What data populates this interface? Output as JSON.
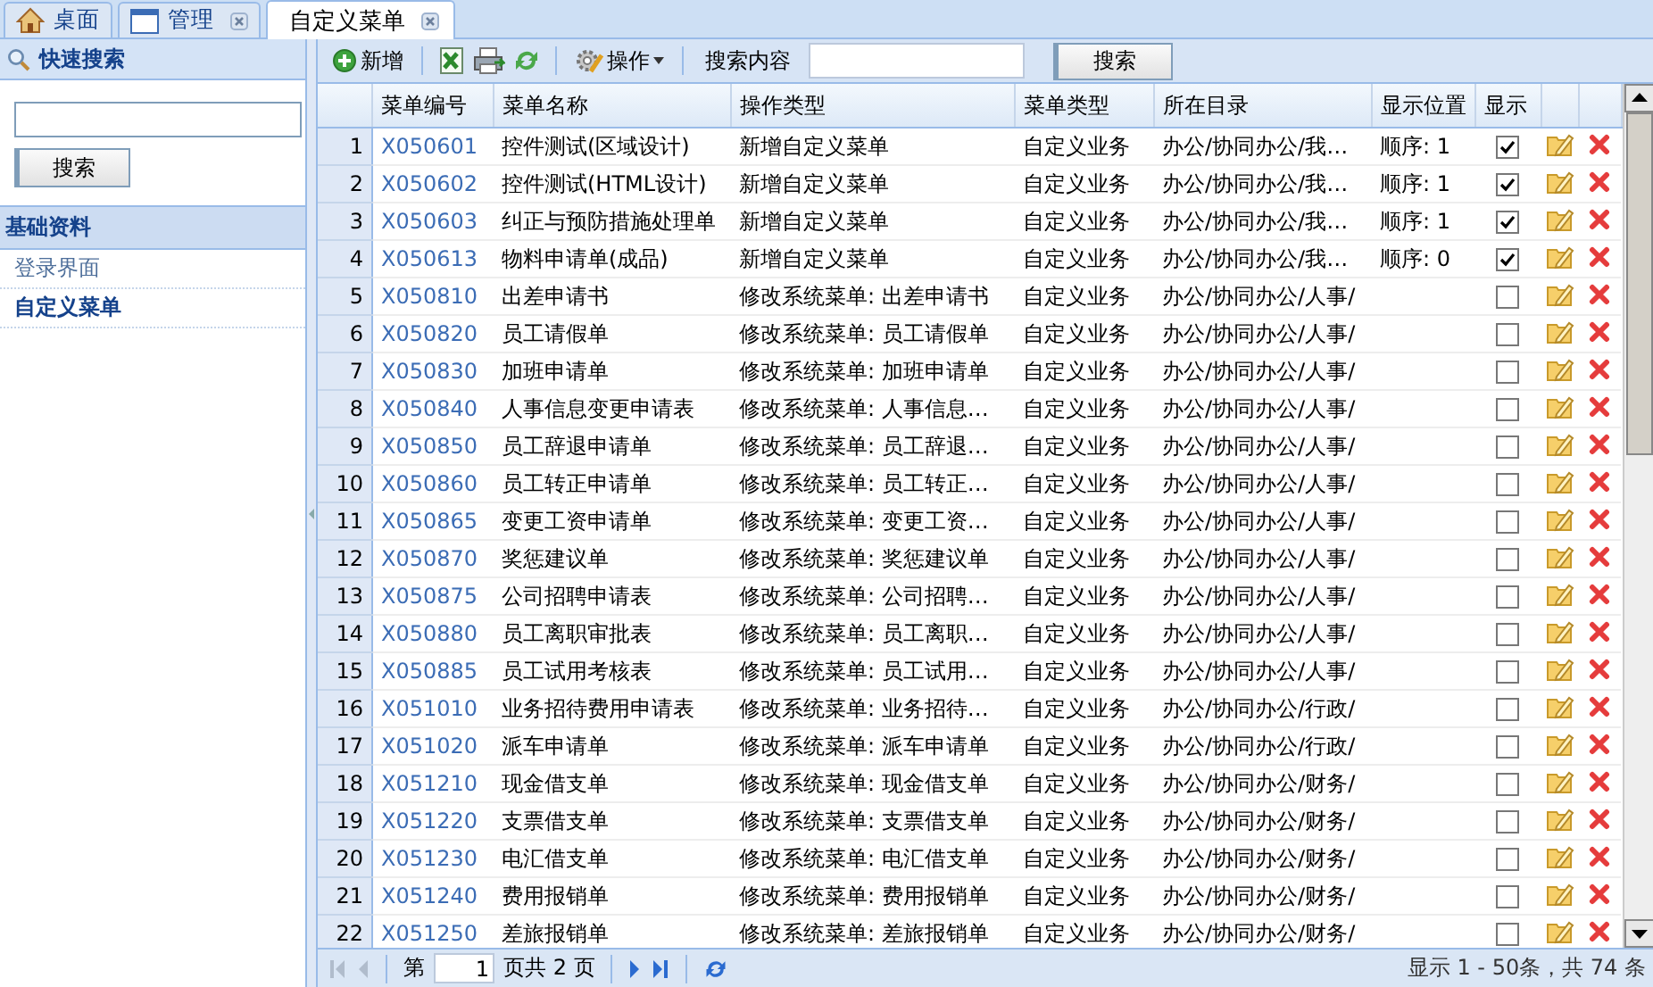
{
  "tabs": [
    {
      "label": "桌面",
      "kind": "home",
      "closable": false,
      "selected": false
    },
    {
      "label": "管理",
      "kind": "window",
      "closable": true,
      "selected": false
    },
    {
      "label": "自定义菜单",
      "kind": "plain",
      "closable": true,
      "selected": true
    }
  ],
  "sidebar": {
    "search_title": "快速搜索",
    "search_button": "搜索",
    "section_title": "基础资料",
    "items": [
      {
        "label": "登录界面",
        "selected": false
      },
      {
        "label": "自定义菜单",
        "selected": true
      }
    ]
  },
  "toolbar": {
    "add": "新增",
    "actions": "操作",
    "search_label": "搜索内容",
    "search_button": "搜索"
  },
  "table": {
    "columns": [
      "菜单编号",
      "菜单名称",
      "操作类型",
      "菜单类型",
      "所在目录",
      "显示位置",
      "显示"
    ],
    "rows": [
      {
        "num": "1",
        "code": "X050601",
        "name": "控件测试(区域设计)",
        "op": "新增自定义菜单",
        "type": "自定义业务",
        "dir": "办公/协同办公/我…",
        "pos": "顺序: 1",
        "shown": true
      },
      {
        "num": "2",
        "code": "X050602",
        "name": "控件测试(HTML设计)",
        "op": "新增自定义菜单",
        "type": "自定义业务",
        "dir": "办公/协同办公/我…",
        "pos": "顺序: 1",
        "shown": true
      },
      {
        "num": "3",
        "code": "X050603",
        "name": "纠正与预防措施处理单",
        "op": "新增自定义菜单",
        "type": "自定义业务",
        "dir": "办公/协同办公/我…",
        "pos": "顺序: 1",
        "shown": true
      },
      {
        "num": "4",
        "code": "X050613",
        "name": "物料申请单(成品)",
        "op": "新增自定义菜单",
        "type": "自定义业务",
        "dir": "办公/协同办公/我…",
        "pos": "顺序: 0",
        "shown": true
      },
      {
        "num": "5",
        "code": "X050810",
        "name": "出差申请书",
        "op": "修改系统菜单: 出差申请书",
        "type": "自定义业务",
        "dir": "办公/协同办公/人事/",
        "shown": false
      },
      {
        "num": "6",
        "code": "X050820",
        "name": "员工请假单",
        "op": "修改系统菜单: 员工请假单",
        "type": "自定义业务",
        "dir": "办公/协同办公/人事/",
        "shown": false
      },
      {
        "num": "7",
        "code": "X050830",
        "name": "加班申请单",
        "op": "修改系统菜单: 加班申请单",
        "type": "自定义业务",
        "dir": "办公/协同办公/人事/",
        "shown": false
      },
      {
        "num": "8",
        "code": "X050840",
        "name": "人事信息变更申请表",
        "op": "修改系统菜单: 人事信息…",
        "type": "自定义业务",
        "dir": "办公/协同办公/人事/",
        "shown": false
      },
      {
        "num": "9",
        "code": "X050850",
        "name": "员工辞退申请单",
        "op": "修改系统菜单: 员工辞退…",
        "type": "自定义业务",
        "dir": "办公/协同办公/人事/",
        "shown": false
      },
      {
        "num": "10",
        "code": "X050860",
        "name": "员工转正申请单",
        "op": "修改系统菜单: 员工转正…",
        "type": "自定义业务",
        "dir": "办公/协同办公/人事/",
        "shown": false
      },
      {
        "num": "11",
        "code": "X050865",
        "name": "变更工资申请单",
        "op": "修改系统菜单: 变更工资…",
        "type": "自定义业务",
        "dir": "办公/协同办公/人事/",
        "shown": false
      },
      {
        "num": "12",
        "code": "X050870",
        "name": "奖惩建议单",
        "op": "修改系统菜单: 奖惩建议单",
        "type": "自定义业务",
        "dir": "办公/协同办公/人事/",
        "shown": false
      },
      {
        "num": "13",
        "code": "X050875",
        "name": "公司招聘申请表",
        "op": "修改系统菜单: 公司招聘…",
        "type": "自定义业务",
        "dir": "办公/协同办公/人事/",
        "shown": false
      },
      {
        "num": "14",
        "code": "X050880",
        "name": "员工离职审批表",
        "op": "修改系统菜单: 员工离职…",
        "type": "自定义业务",
        "dir": "办公/协同办公/人事/",
        "shown": false
      },
      {
        "num": "15",
        "code": "X050885",
        "name": "员工试用考核表",
        "op": "修改系统菜单: 员工试用…",
        "type": "自定义业务",
        "dir": "办公/协同办公/人事/",
        "shown": false
      },
      {
        "num": "16",
        "code": "X051010",
        "name": "业务招待费用申请表",
        "op": "修改系统菜单: 业务招待…",
        "type": "自定义业务",
        "dir": "办公/协同办公/行政/",
        "shown": false
      },
      {
        "num": "17",
        "code": "X051020",
        "name": "派车申请单",
        "op": "修改系统菜单: 派车申请单",
        "type": "自定义业务",
        "dir": "办公/协同办公/行政/",
        "shown": false
      },
      {
        "num": "18",
        "code": "X051210",
        "name": "现金借支单",
        "op": "修改系统菜单: 现金借支单",
        "type": "自定义业务",
        "dir": "办公/协同办公/财务/",
        "shown": false
      },
      {
        "num": "19",
        "code": "X051220",
        "name": "支票借支单",
        "op": "修改系统菜单: 支票借支单",
        "type": "自定义业务",
        "dir": "办公/协同办公/财务/",
        "shown": false
      },
      {
        "num": "20",
        "code": "X051230",
        "name": "电汇借支单",
        "op": "修改系统菜单: 电汇借支单",
        "type": "自定义业务",
        "dir": "办公/协同办公/财务/",
        "shown": false
      },
      {
        "num": "21",
        "code": "X051240",
        "name": "费用报销单",
        "op": "修改系统菜单: 费用报销单",
        "type": "自定义业务",
        "dir": "办公/协同办公/财务/",
        "shown": false
      },
      {
        "num": "22",
        "code": "X051250",
        "name": "差旅报销单",
        "op": "修改系统菜单: 差旅报销单",
        "type": "自定义业务",
        "dir": "办公/协同办公/财务/",
        "shown": false
      }
    ]
  },
  "pager": {
    "page_prefix": "第",
    "page": "1",
    "page_suffix": "页共 2 页",
    "summary": "显示 1 - 50条，共 74 条"
  }
}
